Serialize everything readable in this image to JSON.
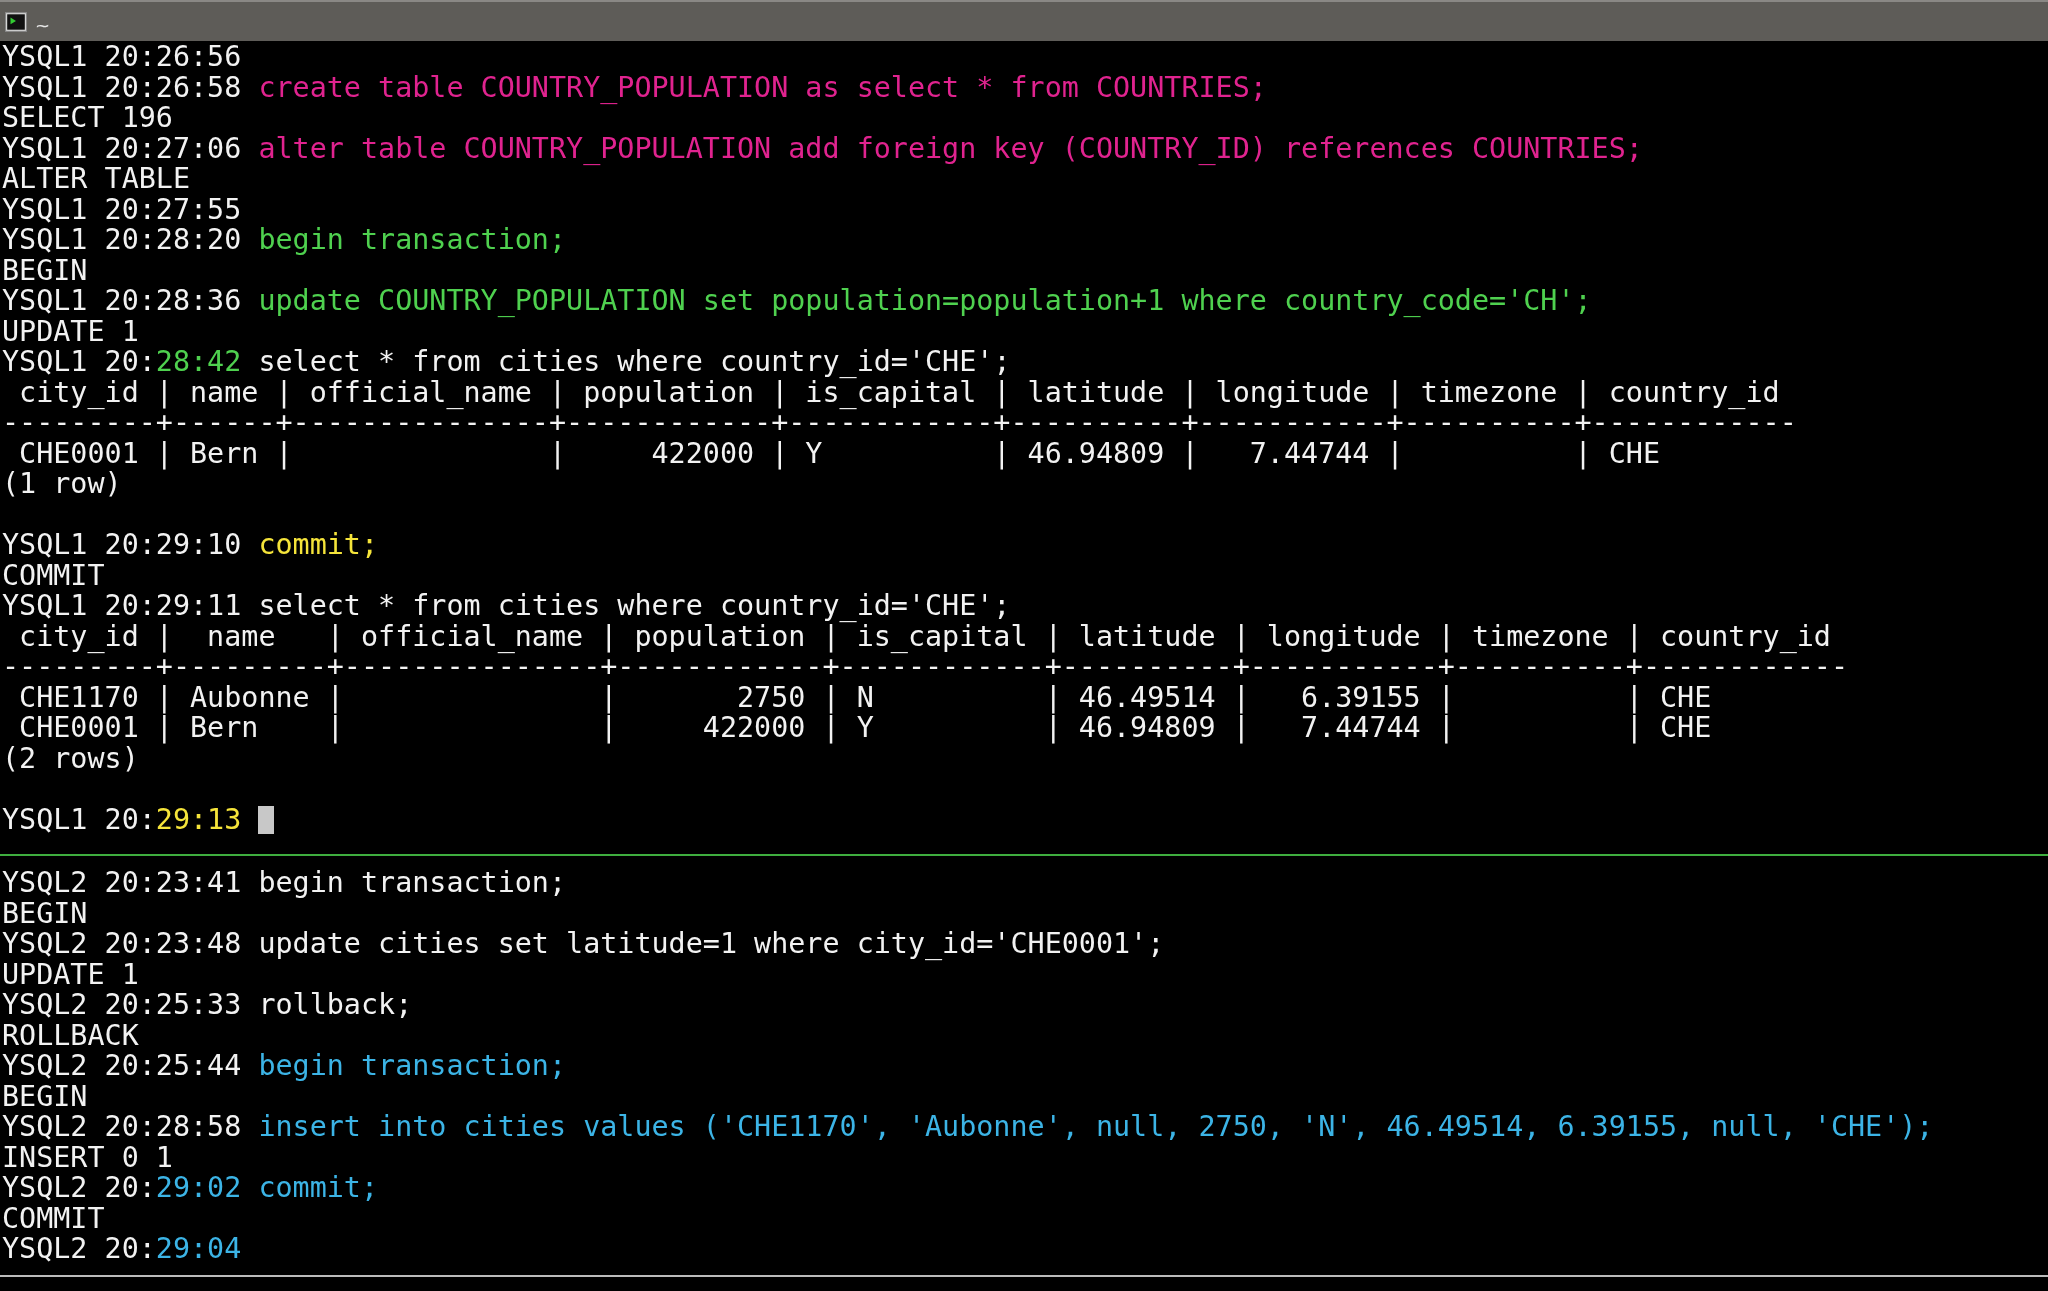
{
  "window": {
    "title": "~"
  },
  "panes": [
    {
      "lines": [
        {
          "kind": "line",
          "segments": [
            {
              "text": "YSQL1 20:26:56",
              "color": "#f2f2f2"
            }
          ]
        },
        {
          "kind": "line",
          "segments": [
            {
              "text": "YSQL1 20:26:58 ",
              "color": "#f2f2f2"
            },
            {
              "text": "create table COUNTRY_POPULATION as select * from COUNTRIES;",
              "color": "#e0238f"
            }
          ]
        },
        {
          "kind": "line",
          "segments": [
            {
              "text": "SELECT 196",
              "color": "#f2f2f2"
            }
          ]
        },
        {
          "kind": "line",
          "segments": [
            {
              "text": "YSQL1 20:27:06 ",
              "color": "#f2f2f2"
            },
            {
              "text": "alter table COUNTRY_POPULATION add foreign key (COUNTRY_ID) references COUNTRIES;",
              "color": "#e0238f"
            }
          ]
        },
        {
          "kind": "line",
          "segments": [
            {
              "text": "ALTER TABLE",
              "color": "#f2f2f2"
            }
          ]
        },
        {
          "kind": "line",
          "segments": [
            {
              "text": "YSQL1 20:27:55",
              "color": "#f2f2f2"
            }
          ]
        },
        {
          "kind": "line",
          "segments": [
            {
              "text": "YSQL1 20:28:20 ",
              "color": "#f2f2f2"
            },
            {
              "text": "begin transaction;",
              "color": "#4fd14f"
            }
          ]
        },
        {
          "kind": "line",
          "segments": [
            {
              "text": "BEGIN",
              "color": "#f2f2f2"
            }
          ]
        },
        {
          "kind": "line",
          "segments": [
            {
              "text": "YSQL1 20:28:36 ",
              "color": "#f2f2f2"
            },
            {
              "text": "update COUNTRY_POPULATION set population=population+1 where country_code='CH';",
              "color": "#4fd14f"
            }
          ]
        },
        {
          "kind": "line",
          "segments": [
            {
              "text": "UPDATE 1",
              "color": "#f2f2f2"
            }
          ]
        },
        {
          "kind": "line",
          "segments": [
            {
              "text": "YSQL1 20:",
              "color": "#f2f2f2"
            },
            {
              "text": "28:42",
              "color": "#4fd14f"
            },
            {
              "text": " select * from cities where country_id='CHE';",
              "color": "#f2f2f2"
            }
          ]
        },
        {
          "kind": "line",
          "segments": [
            {
              "text": " city_id | name | official_name | population | is_capital | latitude | longitude | timezone | country_id",
              "color": "#f2f2f2"
            }
          ]
        },
        {
          "kind": "line",
          "segments": [
            {
              "text": "---------+------+---------------+------------+------------+----------+-----------+----------+------------",
              "color": "#f2f2f2"
            }
          ]
        },
        {
          "kind": "line",
          "segments": [
            {
              "text": " CHE0001 | Bern |               |     422000 | Y          | 46.94809 |   7.44744 |          | CHE",
              "color": "#f2f2f2"
            }
          ]
        },
        {
          "kind": "line",
          "segments": [
            {
              "text": "(1 row)",
              "color": "#f2f2f2"
            }
          ]
        },
        {
          "kind": "blank"
        },
        {
          "kind": "line",
          "segments": [
            {
              "text": "YSQL1 20:29:10 ",
              "color": "#f2f2f2"
            },
            {
              "text": "commit;",
              "color": "#f5e43a"
            }
          ]
        },
        {
          "kind": "line",
          "segments": [
            {
              "text": "COMMIT",
              "color": "#f2f2f2"
            }
          ]
        },
        {
          "kind": "line",
          "segments": [
            {
              "text": "YSQL1 20:29:11 select * from cities where country_id='CHE';",
              "color": "#f2f2f2"
            }
          ]
        },
        {
          "kind": "line",
          "segments": [
            {
              "text": " city_id |  name   | official_name | population | is_capital | latitude | longitude | timezone | country_id",
              "color": "#f2f2f2"
            }
          ]
        },
        {
          "kind": "line",
          "segments": [
            {
              "text": "---------+---------+---------------+------------+------------+----------+-----------+----------+------------",
              "color": "#f2f2f2"
            }
          ]
        },
        {
          "kind": "line",
          "segments": [
            {
              "text": " CHE1170 | Aubonne |               |       2750 | N          | 46.49514 |   6.39155 |          | CHE",
              "color": "#f2f2f2"
            }
          ]
        },
        {
          "kind": "line",
          "segments": [
            {
              "text": " CHE0001 | Bern    |               |     422000 | Y          | 46.94809 |   7.44744 |          | CHE",
              "color": "#f2f2f2"
            }
          ]
        },
        {
          "kind": "line",
          "segments": [
            {
              "text": "(2 rows)",
              "color": "#f2f2f2"
            }
          ]
        },
        {
          "kind": "blank"
        },
        {
          "kind": "cursor-line",
          "segments": [
            {
              "text": "YSQL1 20:",
              "color": "#f2f2f2"
            },
            {
              "text": "29:13",
              "color": "#f5e43a"
            }
          ]
        }
      ]
    },
    {
      "lines": [
        {
          "kind": "line",
          "segments": [
            {
              "text": "YSQL2 20:23:41 begin transaction;",
              "color": "#f2f2f2"
            }
          ]
        },
        {
          "kind": "line",
          "segments": [
            {
              "text": "BEGIN",
              "color": "#f2f2f2"
            }
          ]
        },
        {
          "kind": "line",
          "segments": [
            {
              "text": "YSQL2 20:23:48 update cities set latitude=1 where city_id='CHE0001';",
              "color": "#f2f2f2"
            }
          ]
        },
        {
          "kind": "line",
          "segments": [
            {
              "text": "UPDATE 1",
              "color": "#f2f2f2"
            }
          ]
        },
        {
          "kind": "line",
          "segments": [
            {
              "text": "YSQL2 20:25:33 rollback;",
              "color": "#f2f2f2"
            }
          ]
        },
        {
          "kind": "line",
          "segments": [
            {
              "text": "ROLLBACK",
              "color": "#f2f2f2"
            }
          ]
        },
        {
          "kind": "line",
          "segments": [
            {
              "text": "YSQL2 20:25:44 ",
              "color": "#f2f2f2"
            },
            {
              "text": "begin transaction;",
              "color": "#3cb4e6"
            }
          ]
        },
        {
          "kind": "line",
          "segments": [
            {
              "text": "BEGIN",
              "color": "#f2f2f2"
            }
          ]
        },
        {
          "kind": "line",
          "segments": [
            {
              "text": "YSQL2 20:28:58 ",
              "color": "#f2f2f2"
            },
            {
              "text": "insert into cities values ('CHE1170', 'Aubonne', null, 2750, 'N', 46.49514, 6.39155, null, 'CHE');",
              "color": "#3cb4e6"
            }
          ]
        },
        {
          "kind": "line",
          "segments": [
            {
              "text": "INSERT 0 1",
              "color": "#f2f2f2"
            }
          ]
        },
        {
          "kind": "line",
          "segments": [
            {
              "text": "YSQL2 20:",
              "color": "#f2f2f2"
            },
            {
              "text": "29:02 commit;",
              "color": "#3cb4e6"
            }
          ]
        },
        {
          "kind": "line",
          "segments": [
            {
              "text": "COMMIT",
              "color": "#f2f2f2"
            }
          ]
        },
        {
          "kind": "line",
          "segments": [
            {
              "text": "YSQL2 20:",
              "color": "#f2f2f2"
            },
            {
              "text": "29:04",
              "color": "#3cb4e6"
            }
          ]
        }
      ]
    }
  ]
}
